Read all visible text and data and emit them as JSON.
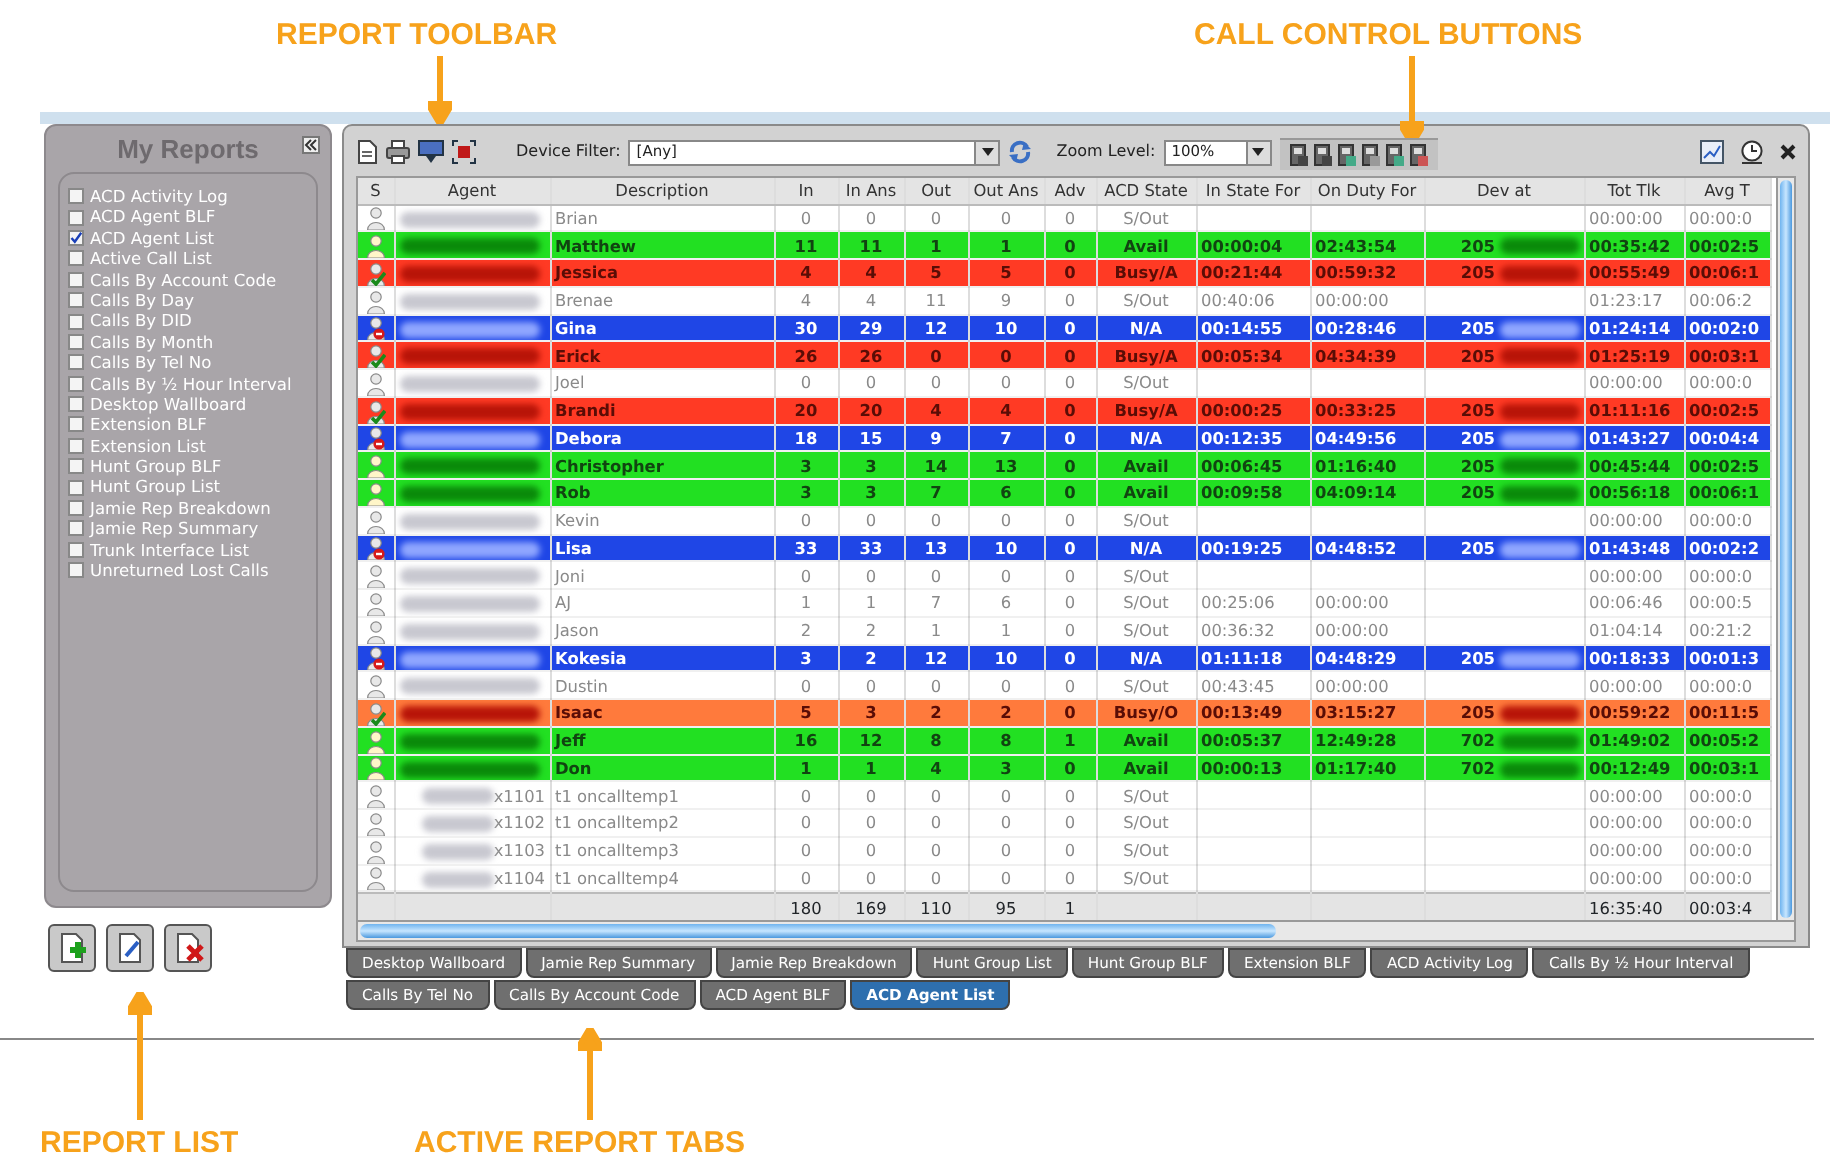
{
  "callouts_top": [
    "REPORT TOOLBAR",
    "CALL CONTROL BUTTONS"
  ],
  "callouts_bottom": [
    "REPORT LIST",
    "ACTIVE REPORT TABS"
  ],
  "sidebar": {
    "title": "My Reports",
    "items": [
      {
        "label": "ACD Activity Log",
        "checked": false
      },
      {
        "label": "ACD Agent BLF",
        "checked": false
      },
      {
        "label": "ACD Agent List",
        "checked": true
      },
      {
        "label": "Active Call List",
        "checked": false
      },
      {
        "label": "Calls By Account Code",
        "checked": false
      },
      {
        "label": "Calls By Day",
        "checked": false
      },
      {
        "label": "Calls By DID",
        "checked": false
      },
      {
        "label": "Calls By Month",
        "checked": false
      },
      {
        "label": "Calls By Tel No",
        "checked": false
      },
      {
        "label": "Calls By ½ Hour Interval",
        "checked": false
      },
      {
        "label": "Desktop Wallboard",
        "checked": false
      },
      {
        "label": "Extension BLF",
        "checked": false
      },
      {
        "label": "Extension List",
        "checked": false
      },
      {
        "label": "Hunt Group BLF",
        "checked": false
      },
      {
        "label": "Hunt Group List",
        "checked": false
      },
      {
        "label": "Jamie Rep Breakdown",
        "checked": false
      },
      {
        "label": "Jamie Rep Summary",
        "checked": false
      },
      {
        "label": "Trunk Interface List",
        "checked": false
      },
      {
        "label": "Unreturned Lost Calls",
        "checked": false
      }
    ]
  },
  "toolbar": {
    "device_filter_label": "Device Filter:",
    "device_filter_value": "[Any]",
    "zoom_label": "Zoom Level:",
    "zoom_value": "100%"
  },
  "table": {
    "columns": [
      "S",
      "Agent",
      "Description",
      "In",
      "In Ans",
      "Out",
      "Out Ans",
      "Adv",
      "ACD State",
      "In State For",
      "On Duty For",
      "Dev at",
      "Tot Tlk",
      "Avg T"
    ],
    "rows": [
      {
        "kind": "idle",
        "color": "#ffffff",
        "description": "Brian",
        "in": "0",
        "in_ans": "0",
        "out": "0",
        "out_ans": "0",
        "adv": "0",
        "acd_state": "S/Out",
        "tot_tlk": "00:00:00",
        "avg_t": "00:00:0"
      },
      {
        "kind": "available",
        "color": "#22e022",
        "description": "Matthew",
        "in": "11",
        "in_ans": "11",
        "out": "1",
        "out_ans": "1",
        "adv": "0",
        "acd_state": "Avail",
        "in_state_for": "00:00:04",
        "on_duty_for": "02:43:54",
        "dev_at": "205",
        "tot_tlk": "00:35:42",
        "avg_t": "00:02:5"
      },
      {
        "kind": "busy",
        "color": "#ff3a24",
        "description": "Jessica",
        "in": "4",
        "in_ans": "4",
        "out": "5",
        "out_ans": "5",
        "adv": "0",
        "acd_state": "Busy/A",
        "in_state_for": "00:21:44",
        "on_duty_for": "00:59:32",
        "dev_at": "205",
        "tot_tlk": "00:55:49",
        "avg_t": "00:06:1"
      },
      {
        "kind": "idle",
        "color": "#ffffff",
        "description": "Brenae",
        "in": "4",
        "in_ans": "4",
        "out": "11",
        "out_ans": "9",
        "adv": "0",
        "acd_state": "S/Out",
        "in_state_for": "00:40:06",
        "on_duty_for": "00:00:00",
        "tot_tlk": "01:23:17",
        "avg_t": "00:06:2"
      },
      {
        "kind": "unavailable",
        "color": "#1f46e6",
        "description": "Gina",
        "in": "30",
        "in_ans": "29",
        "out": "12",
        "out_ans": "10",
        "adv": "0",
        "acd_state": "N/A",
        "in_state_for": "00:14:55",
        "on_duty_for": "00:28:46",
        "dev_at": "205",
        "tot_tlk": "01:24:14",
        "avg_t": "00:02:0"
      },
      {
        "kind": "busy",
        "color": "#ff3a24",
        "description": "Erick",
        "in": "26",
        "in_ans": "26",
        "out": "0",
        "out_ans": "0",
        "adv": "0",
        "acd_state": "Busy/A",
        "in_state_for": "00:05:34",
        "on_duty_for": "04:34:39",
        "dev_at": "205",
        "tot_tlk": "01:25:19",
        "avg_t": "00:03:1"
      },
      {
        "kind": "idle",
        "color": "#ffffff",
        "description": "Joel",
        "in": "0",
        "in_ans": "0",
        "out": "0",
        "out_ans": "0",
        "adv": "0",
        "acd_state": "S/Out",
        "tot_tlk": "00:00:00",
        "avg_t": "00:00:0"
      },
      {
        "kind": "busy",
        "color": "#ff3a24",
        "description": "Brandi",
        "in": "20",
        "in_ans": "20",
        "out": "4",
        "out_ans": "4",
        "adv": "0",
        "acd_state": "Busy/A",
        "in_state_for": "00:00:25",
        "on_duty_for": "00:33:25",
        "dev_at": "205",
        "tot_tlk": "01:11:16",
        "avg_t": "00:02:5"
      },
      {
        "kind": "unavailable",
        "color": "#1f46e6",
        "description": "Debora",
        "in": "18",
        "in_ans": "15",
        "out": "9",
        "out_ans": "7",
        "adv": "0",
        "acd_state": "N/A",
        "in_state_for": "00:12:35",
        "on_duty_for": "04:49:56",
        "dev_at": "205",
        "tot_tlk": "01:43:27",
        "avg_t": "00:04:4"
      },
      {
        "kind": "available",
        "color": "#22e022",
        "description": "Christopher",
        "in": "3",
        "in_ans": "3",
        "out": "14",
        "out_ans": "13",
        "adv": "0",
        "acd_state": "Avail",
        "in_state_for": "00:06:45",
        "on_duty_for": "01:16:40",
        "dev_at": "205",
        "tot_tlk": "00:45:44",
        "avg_t": "00:02:5"
      },
      {
        "kind": "available",
        "color": "#22e022",
        "description": "Rob",
        "in": "3",
        "in_ans": "3",
        "out": "7",
        "out_ans": "6",
        "adv": "0",
        "acd_state": "Avail",
        "in_state_for": "00:09:58",
        "on_duty_for": "04:09:14",
        "dev_at": "205",
        "tot_tlk": "00:56:18",
        "avg_t": "00:06:1"
      },
      {
        "kind": "idle",
        "color": "#ffffff",
        "description": "Kevin",
        "in": "0",
        "in_ans": "0",
        "out": "0",
        "out_ans": "0",
        "adv": "0",
        "acd_state": "S/Out",
        "tot_tlk": "00:00:00",
        "avg_t": "00:00:0"
      },
      {
        "kind": "unavailable",
        "color": "#1f46e6",
        "description": "Lisa",
        "in": "33",
        "in_ans": "33",
        "out": "13",
        "out_ans": "10",
        "adv": "0",
        "acd_state": "N/A",
        "in_state_for": "00:19:25",
        "on_duty_for": "04:48:52",
        "dev_at": "205",
        "tot_tlk": "01:43:48",
        "avg_t": "00:02:2"
      },
      {
        "kind": "idle",
        "color": "#ffffff",
        "description": "Joni",
        "in": "0",
        "in_ans": "0",
        "out": "0",
        "out_ans": "0",
        "adv": "0",
        "acd_state": "S/Out",
        "tot_tlk": "00:00:00",
        "avg_t": "00:00:0"
      },
      {
        "kind": "idle",
        "color": "#ffffff",
        "description": "AJ",
        "in": "1",
        "in_ans": "1",
        "out": "7",
        "out_ans": "6",
        "adv": "0",
        "acd_state": "S/Out",
        "in_state_for": "00:25:06",
        "on_duty_for": "00:00:00",
        "tot_tlk": "00:06:46",
        "avg_t": "00:00:5"
      },
      {
        "kind": "idle",
        "color": "#ffffff",
        "description": "Jason",
        "in": "2",
        "in_ans": "2",
        "out": "1",
        "out_ans": "1",
        "adv": "0",
        "acd_state": "S/Out",
        "in_state_for": "00:36:32",
        "on_duty_for": "00:00:00",
        "tot_tlk": "01:04:14",
        "avg_t": "00:21:2"
      },
      {
        "kind": "unavailable",
        "color": "#1f46e6",
        "description": "Kokesia",
        "in": "3",
        "in_ans": "2",
        "out": "12",
        "out_ans": "10",
        "adv": "0",
        "acd_state": "N/A",
        "in_state_for": "01:11:18",
        "on_duty_for": "04:48:29",
        "dev_at": "205",
        "tot_tlk": "00:18:33",
        "avg_t": "00:01:3"
      },
      {
        "kind": "idle",
        "color": "#ffffff",
        "description": "Dustin",
        "in": "0",
        "in_ans": "0",
        "out": "0",
        "out_ans": "0",
        "adv": "0",
        "acd_state": "S/Out",
        "in_state_for": "00:43:45",
        "on_duty_for": "00:00:00",
        "tot_tlk": "00:00:00",
        "avg_t": "00:00:0"
      },
      {
        "kind": "busy",
        "color": "#ff7a3c",
        "description": "Isaac",
        "in": "5",
        "in_ans": "3",
        "out": "2",
        "out_ans": "2",
        "adv": "0",
        "acd_state": "Busy/O",
        "in_state_for": "00:13:49",
        "on_duty_for": "03:15:27",
        "dev_at": "205",
        "tot_tlk": "00:59:22",
        "avg_t": "00:11:5"
      },
      {
        "kind": "available",
        "color": "#22e022",
        "description": "Jeff",
        "in": "16",
        "in_ans": "12",
        "out": "8",
        "out_ans": "8",
        "adv": "1",
        "acd_state": "Avail",
        "in_state_for": "00:05:37",
        "on_duty_for": "12:49:28",
        "dev_at": "702",
        "tot_tlk": "01:49:02",
        "avg_t": "00:05:2"
      },
      {
        "kind": "available",
        "color": "#22e022",
        "description": "Don",
        "in": "1",
        "in_ans": "1",
        "out": "4",
        "out_ans": "3",
        "adv": "0",
        "acd_state": "Avail",
        "in_state_for": "00:00:13",
        "on_duty_for": "01:17:40",
        "dev_at": "702",
        "tot_tlk": "00:12:49",
        "avg_t": "00:03:1"
      },
      {
        "kind": "idle",
        "color": "#ffffff",
        "agent": "x1101",
        "description": "t1 oncalltemp1",
        "in": "0",
        "in_ans": "0",
        "out": "0",
        "out_ans": "0",
        "adv": "0",
        "acd_state": "S/Out",
        "tot_tlk": "00:00:00",
        "avg_t": "00:00:0"
      },
      {
        "kind": "idle",
        "color": "#ffffff",
        "agent": "x1102",
        "description": "t1 oncalltemp2",
        "in": "0",
        "in_ans": "0",
        "out": "0",
        "out_ans": "0",
        "adv": "0",
        "acd_state": "S/Out",
        "tot_tlk": "00:00:00",
        "avg_t": "00:00:0"
      },
      {
        "kind": "idle",
        "color": "#ffffff",
        "agent": "x1103",
        "description": "t1 oncalltemp3",
        "in": "0",
        "in_ans": "0",
        "out": "0",
        "out_ans": "0",
        "adv": "0",
        "acd_state": "S/Out",
        "tot_tlk": "00:00:00",
        "avg_t": "00:00:0"
      },
      {
        "kind": "idle",
        "color": "#ffffff",
        "agent": "x1104",
        "description": "t1 oncalltemp4",
        "in": "0",
        "in_ans": "0",
        "out": "0",
        "out_ans": "0",
        "adv": "0",
        "acd_state": "S/Out",
        "tot_tlk": "00:00:00",
        "avg_t": "00:00:0"
      }
    ],
    "totals": {
      "in": "180",
      "in_ans": "169",
      "out": "110",
      "out_ans": "95",
      "adv": "1",
      "tot_tlk": "16:35:40",
      "avg_t": "00:03:4"
    }
  },
  "tabs": [
    [
      {
        "label": "Desktop Wallboard",
        "selected": false
      },
      {
        "label": "Jamie Rep Summary",
        "selected": false
      },
      {
        "label": "Jamie Rep Breakdown",
        "selected": false
      },
      {
        "label": "Hunt Group List",
        "selected": false
      },
      {
        "label": "Hunt Group BLF",
        "selected": false
      },
      {
        "label": "Extension BLF",
        "selected": false
      },
      {
        "label": "ACD Activity Log",
        "selected": false
      },
      {
        "label": "Calls By ½ Hour Interval",
        "selected": false
      }
    ],
    [
      {
        "label": "Calls By Tel No",
        "selected": false
      },
      {
        "label": "Calls By Account Code",
        "selected": false
      },
      {
        "label": "ACD Agent BLF",
        "selected": false
      },
      {
        "label": "ACD Agent List",
        "selected": true
      }
    ]
  ]
}
